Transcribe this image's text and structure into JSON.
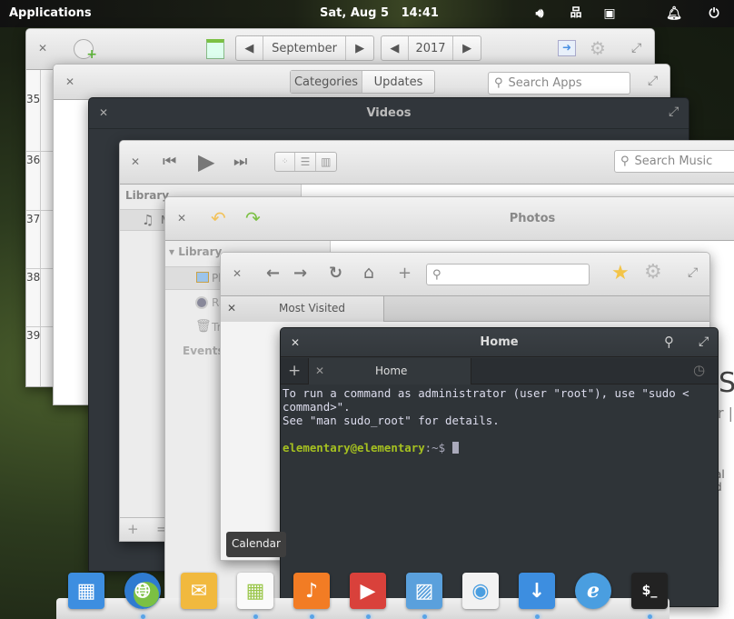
{
  "panel": {
    "applications_label": "Applications",
    "date": "Sat, Aug 5",
    "time": "14:41",
    "indicators": [
      "volume-icon",
      "network-icon",
      "power-battery-icon",
      "notifications-icon",
      "shutdown-icon"
    ]
  },
  "calendar": {
    "month": "September",
    "year": "2017",
    "week_numbers": [
      "35",
      "36",
      "37",
      "38",
      "39"
    ]
  },
  "appcenter": {
    "tabs": [
      "Categories",
      "Updates"
    ],
    "active_tab": "Categories",
    "search_placeholder": "Search Apps"
  },
  "videos": {
    "title": "Videos"
  },
  "music": {
    "search_placeholder": "Search Music",
    "sidebar_heading": "Library",
    "sidebar_item_initial": "M"
  },
  "photos": {
    "title": "Photos",
    "sidebar_heading": "Library",
    "items": [
      "Ph",
      "Ra",
      "Tr"
    ],
    "events_heading": "Events"
  },
  "browser": {
    "tab_label": "Most Visited",
    "url_value": ""
  },
  "terminal": {
    "title": "Home",
    "tab_label": "Home",
    "lines": [
      "To run a command as administrator (user \"root\"), use \"sudo <",
      "command>\".",
      "See \"man sudo_root\" for details."
    ],
    "prompt_user": "elementary@elementary",
    "prompt_path": ":~$ ",
    "partial_right_text": [
      "S",
      "r |",
      "al d"
    ]
  },
  "tooltip": {
    "text": "Calendar"
  },
  "dock": {
    "items": [
      {
        "name": "multitasking-view",
        "color": "#3d8ee0",
        "running": false
      },
      {
        "name": "web-browser",
        "color": "#3a86d8",
        "running": true
      },
      {
        "name": "mail",
        "color": "#f1b93e",
        "running": false
      },
      {
        "name": "calendar",
        "color": "#fafafa",
        "running": true
      },
      {
        "name": "music",
        "color": "#f27c24",
        "running": true
      },
      {
        "name": "videos",
        "color": "#d9413b",
        "running": true
      },
      {
        "name": "photos",
        "color": "#5aa0dc",
        "running": true
      },
      {
        "name": "system-settings",
        "color": "#f2f2f2",
        "running": false
      },
      {
        "name": "appcenter-downloads",
        "color": "#3d8ee0",
        "running": true
      },
      {
        "name": "appcenter",
        "color": "#4a9ee0",
        "running": false
      },
      {
        "name": "terminal",
        "color": "#222",
        "running": true
      }
    ]
  }
}
